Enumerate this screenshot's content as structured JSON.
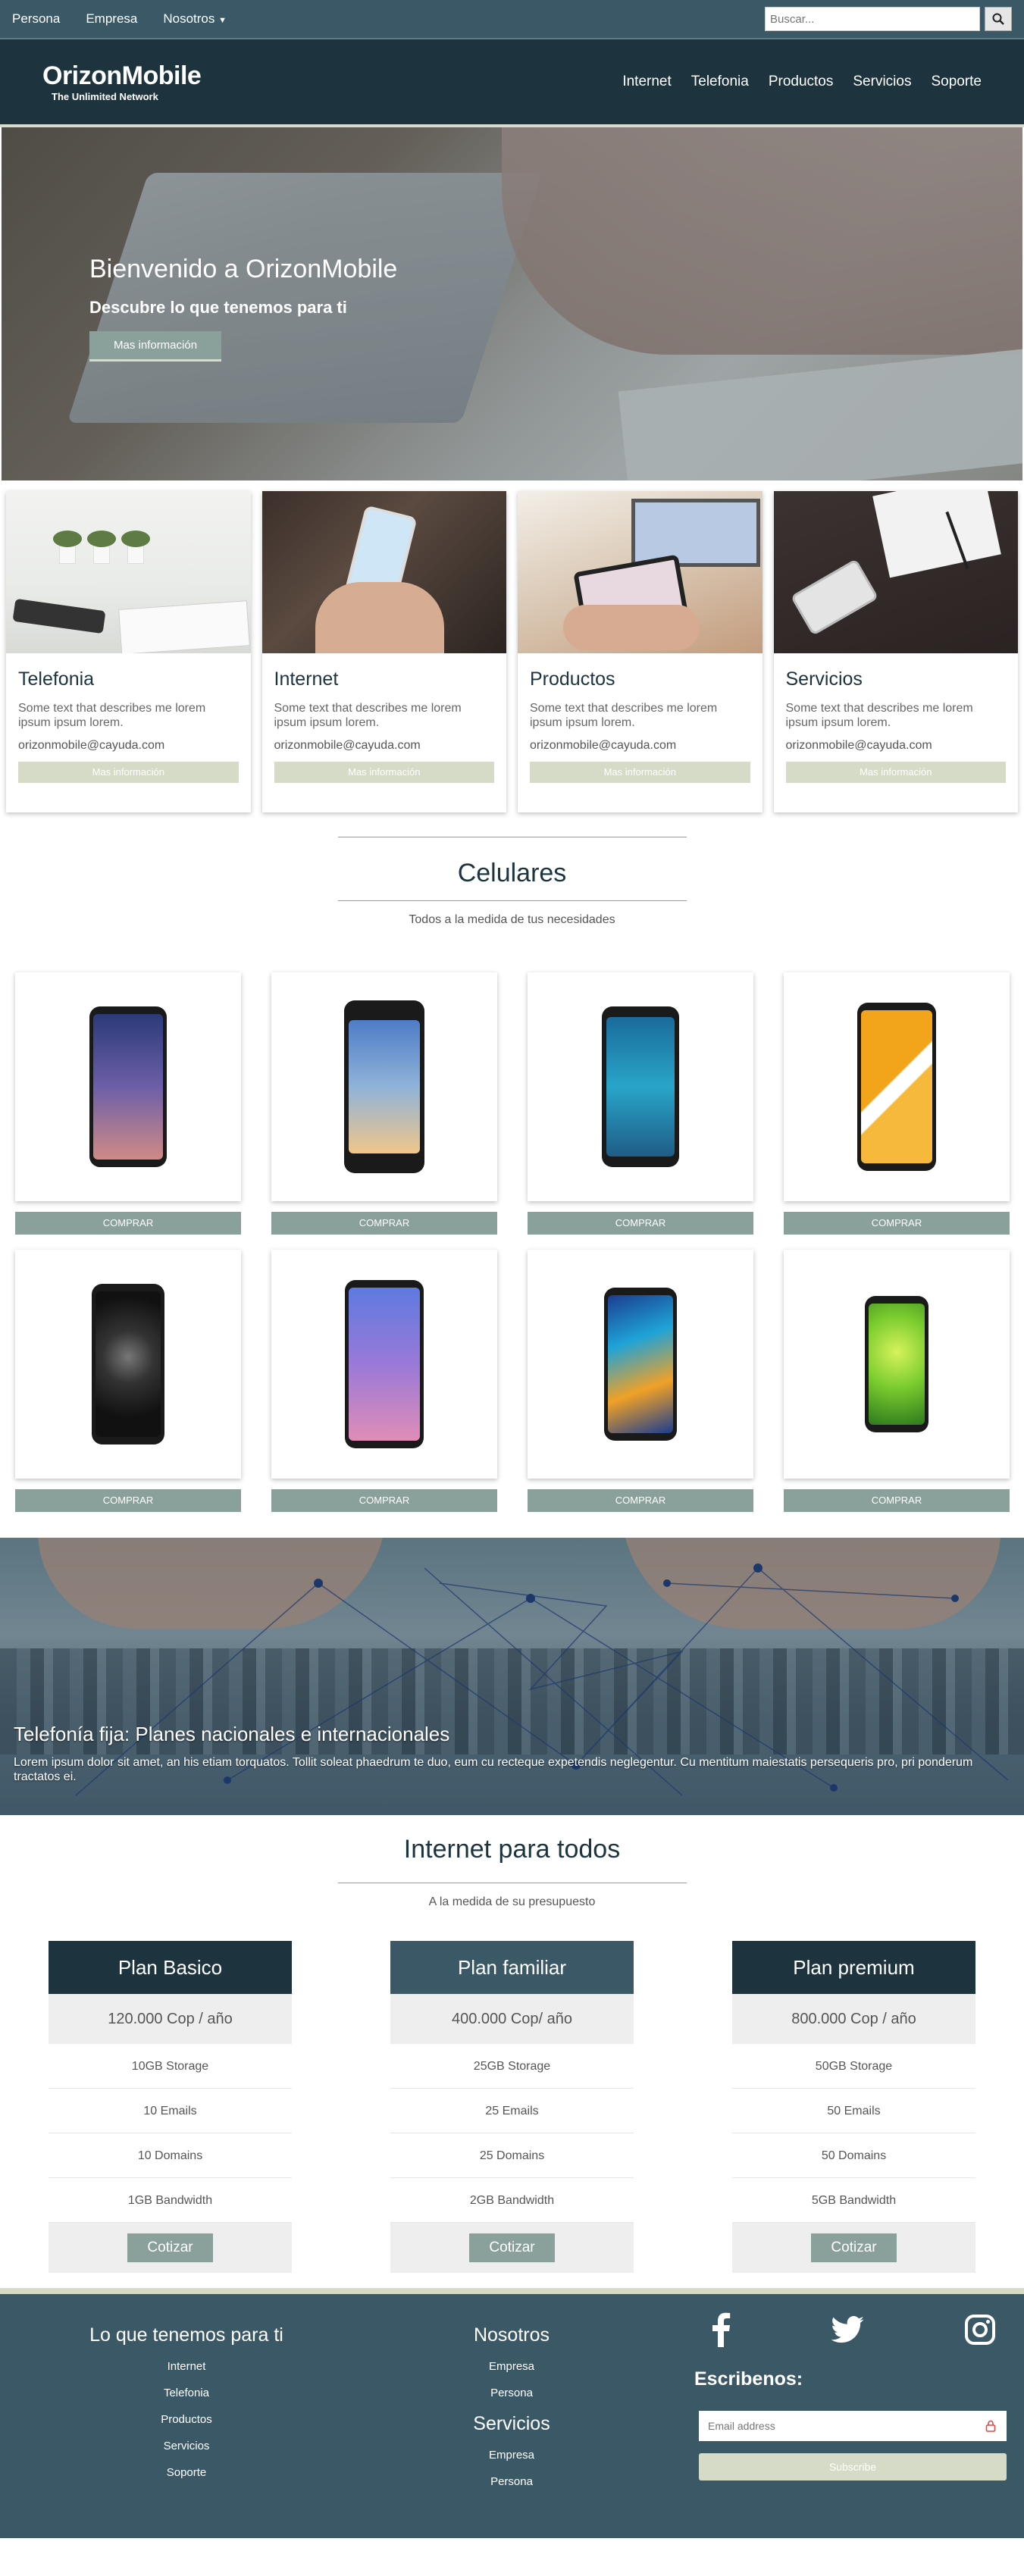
{
  "topbar": {
    "links": [
      "Persona",
      "Empresa",
      "Nosotros"
    ],
    "search_placeholder": "Buscar..."
  },
  "nav": {
    "brand": "OrizonMobile",
    "tagline": "The Unlimited Network",
    "links": [
      "Internet",
      "Telefonia",
      "Productos",
      "Servicios",
      "Soporte"
    ]
  },
  "hero": {
    "title": "Bienvenido a OrizonMobile",
    "subtitle": "Descubre lo que tenemos para ti",
    "button": "Mas información"
  },
  "cards": [
    {
      "title": "Telefonia",
      "text": "Some text that describes me lorem ipsum ipsum lorem.",
      "email": "orizonmobile@cayuda.com",
      "button": "Mas información"
    },
    {
      "title": "Internet",
      "text": "Some text that describes me lorem ipsum ipsum lorem.",
      "email": "orizonmobile@cayuda.com",
      "button": "Mas información"
    },
    {
      "title": "Productos",
      "text": "Some text that describes me lorem ipsum ipsum lorem.",
      "email": "orizonmobile@cayuda.com",
      "button": "Mas información"
    },
    {
      "title": "Servicios",
      "text": "Some text that describes me lorem ipsum ipsum lorem.",
      "email": "orizonmobile@cayuda.com",
      "button": "Mas información"
    }
  ],
  "phones_section": {
    "title": "Celulares",
    "subtitle": "Todos a la medida de tus necesidades",
    "buy_label": "COMPRAR"
  },
  "banner": {
    "title": "Telefonía fija: Planes nacionales e internacionales",
    "text": "Lorem ipsum dolor sit amet, an his etiam torquatos. Tollit soleat phaedrum te duo, eum cu recteque expetendis neglegentur. Cu mentitum maiestatis persequeris pro, pri ponderum tractatos ei."
  },
  "internet_section": {
    "title": "Internet para todos",
    "subtitle": "A la medida de su presupuesto"
  },
  "plans": [
    {
      "name": "Plan Basico",
      "price": "120.000 Cop / año",
      "features": [
        "10GB Storage",
        "10 Emails",
        "10 Domains",
        "1GB Bandwidth"
      ],
      "button": "Cotizar",
      "header_color": "#1d343f"
    },
    {
      "name": "Plan familiar",
      "price": "400.000 Cop/ año",
      "features": [
        "25GB Storage",
        "25 Emails",
        "25 Domains",
        "2GB Bandwidth"
      ],
      "button": "Cotizar",
      "header_color": "#3a5866"
    },
    {
      "name": "Plan premium",
      "price": "800.000 Cop / año",
      "features": [
        "50GB Storage",
        "50 Emails",
        "50 Domains",
        "5GB Bandwidth"
      ],
      "button": "Cotizar",
      "header_color": "#1d343f"
    }
  ],
  "footer": {
    "col1_title": "Lo que tenemos para ti",
    "col1_links": [
      "Internet",
      "Telefonia",
      "Productos",
      "Servicios",
      "Soporte"
    ],
    "col2_title": "Nosotros",
    "col2_links": [
      "Empresa",
      "Persona"
    ],
    "col3_title": "Servicios",
    "col3_links": [
      "Empresa",
      "Persona"
    ],
    "subscribe_title": "Escribenos:",
    "email_placeholder": "Email address",
    "subscribe_button": "Subscribe"
  }
}
